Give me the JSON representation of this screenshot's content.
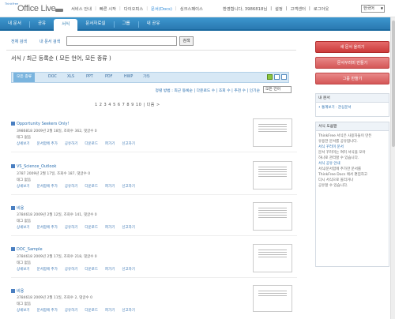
{
  "header": {
    "logo_small": "ThinkFree",
    "logo_big": "Office Live",
    "nav": [
      "서비스 안내",
      "빠른 시작",
      "다이오피스",
      "문서(Docs)",
      "싱크스페이스"
    ],
    "user": [
      "환영합니다, 3986818님",
      "설정",
      "고객센터",
      "로그아웃"
    ],
    "language": "한국어"
  },
  "navbar": {
    "tabs": [
      "내 문서",
      "공유",
      "서식",
      "문서자료실",
      "그룹",
      "내 공유"
    ],
    "active_index": 2
  },
  "search": {
    "tab_all": "전체 검색",
    "tab_my": "내 문서 검색",
    "placeholder": "",
    "button": "검색"
  },
  "heading": "서식 / 최근 등록순 ( 모든 언어, 모든 종류 )",
  "filters": {
    "tabs": [
      "모든 종류",
      "DOC",
      "XLS",
      "PPT",
      "PDF",
      "HWP",
      "기타"
    ],
    "active_index": 0
  },
  "sort": {
    "links": "정렬 방법 : 최근 등록순 | 다운로드 수 | 조회 수 | 추천 수 | 인기순",
    "select": "모든 언어"
  },
  "pager": "1 2 3 4 5 6 7 8 9 10 | 다음 >",
  "documents": [
    {
      "title": "Opportunity Seekers Only!",
      "meta": "3986818 2009년 2월 18일, 조회수 362, 댓글수 0",
      "desc": "태그 없음",
      "actions": [
        "상세보기",
        "문서함에 추가",
        "공유하기",
        "다운로드",
        "퍼가기",
        "신고하기"
      ]
    },
    {
      "title": "VS_Science_Outlook",
      "meta": "3787 2009년 2월 17일, 조회수 187, 댓글수 0",
      "desc": "태그 없음",
      "actions": [
        "상세보기",
        "문서함에 추가",
        "공유하기",
        "다운로드",
        "퍼가기",
        "신고하기"
      ]
    },
    {
      "title": "비용",
      "meta": "3784618 2009년 2월 12일, 조회수 141, 댓글수 0",
      "desc": "태그 없음",
      "actions": [
        "상세보기",
        "문서함에 추가",
        "공유하기",
        "다운로드",
        "퍼가기",
        "신고하기"
      ]
    },
    {
      "title": "DOC_Sample",
      "meta": "3784618 2009년 2월 17일, 조회수 218, 댓글수 0",
      "desc": "태그 없음",
      "actions": [
        "상세보기",
        "문서함에 추가",
        "공유하기",
        "다운로드",
        "퍼가기",
        "신고하기"
      ]
    },
    {
      "title": "비용",
      "meta": "3784618 2009년 2월 11일, 조회수 2, 댓글수 0",
      "desc": "태그 없음",
      "actions": [
        "상세보기",
        "문서함에 추가",
        "공유하기",
        "다운로드",
        "퍼가기",
        "신고하기"
      ]
    }
  ],
  "sidebar": {
    "buttons": [
      "새 문서 올리기",
      "문서꾸러미 만들기",
      "그룹 만들기"
    ],
    "panel1_head": "내 문서",
    "panel1_body": "• 통계보기 · 관심문서",
    "panel2_head": "서식 도움말",
    "panel2_lines": [
      "ThinkFree 서식은 사용자들이 만든",
      "유용한 문서를 공유합니다.",
      "서식 꾸러미 문서",
      "문서 꾸러미는 여러 서식을 모아",
      "하나로 관리할 수 있습니다.",
      "서식 공유 안내",
      "서식/문서함에 추가한 문서를",
      "ThinkFree Docs 에서 편집하고",
      "다시 서식으로 올리거나",
      "공유할 수 있습니다."
    ]
  }
}
